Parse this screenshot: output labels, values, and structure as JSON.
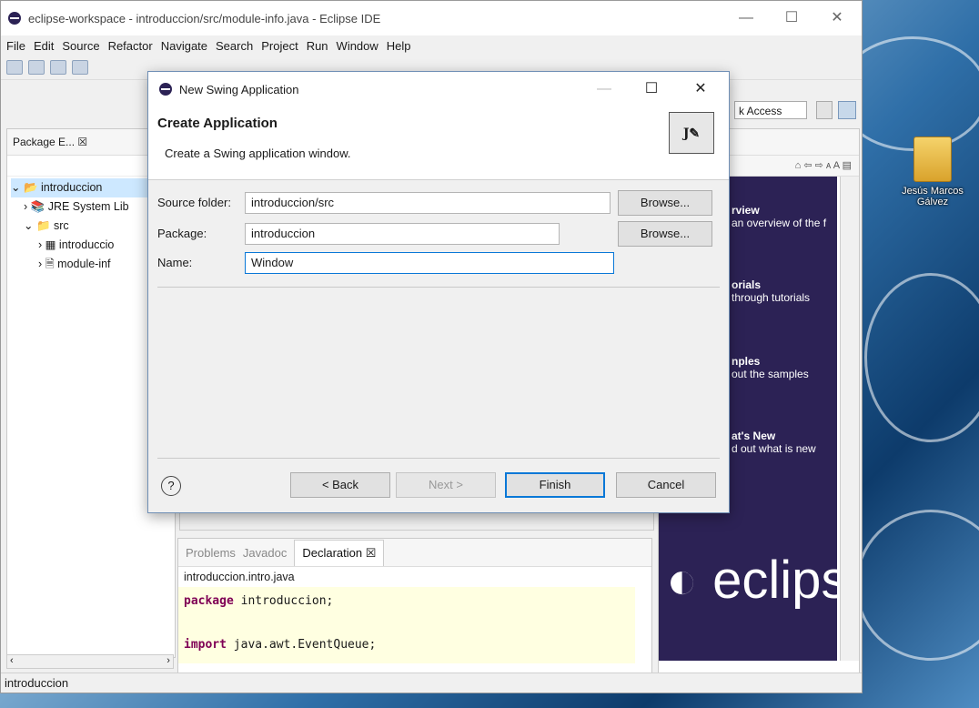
{
  "desktop": {
    "icon_label": "Jesús Marcos Gálvez"
  },
  "window": {
    "title": "eclipse-workspace - introduccion/src/module-info.java - Eclipse IDE",
    "minimize": "—",
    "maximize": "☐",
    "close": "✕"
  },
  "menu": [
    "File",
    "Edit",
    "Source",
    "Refactor",
    "Navigate",
    "Search",
    "Project",
    "Run",
    "Window",
    "Help"
  ],
  "toolbar": {
    "quick_access": "k Access"
  },
  "package_explorer": {
    "tab_label": "Package E... ☒",
    "tree": [
      "introduccion",
      "JRE System Lib",
      "src",
      "introduccio",
      "module-inf"
    ]
  },
  "welcome": {
    "sections": [
      {
        "title": "rview",
        "desc": "an overview of the f"
      },
      {
        "title": "orials",
        "desc": "through tutorials"
      },
      {
        "title": "nples",
        "desc": "out the samples"
      },
      {
        "title": "at's New",
        "desc": "d out what is new"
      }
    ],
    "brand": "eclips"
  },
  "bottom_panel": {
    "tabs": [
      "Problems",
      "Javadoc",
      "Declaration ☒"
    ],
    "path": "introduccion.intro.java",
    "code": [
      {
        "kw": "package",
        "rest": " introduccion;"
      },
      {
        "kw": "",
        "rest": ""
      },
      {
        "kw": "import",
        "rest": " java.awt.EventQueue;"
      }
    ]
  },
  "status": {
    "text": "introduccion"
  },
  "dialog": {
    "title": "New Swing Application",
    "header_title": "Create Application",
    "header_desc": "Create a Swing application window.",
    "fields": [
      {
        "label": "Source folder:",
        "value": "introduccion/src",
        "button": "Browse..."
      },
      {
        "label": "Package:",
        "value": "introduccion",
        "button": "Browse..."
      },
      {
        "label": "Name:",
        "value": "Window",
        "button": ""
      }
    ],
    "help": "?",
    "buttons": {
      "back": "< Back",
      "next": "Next >",
      "finish": "Finish",
      "cancel": "Cancel"
    }
  }
}
